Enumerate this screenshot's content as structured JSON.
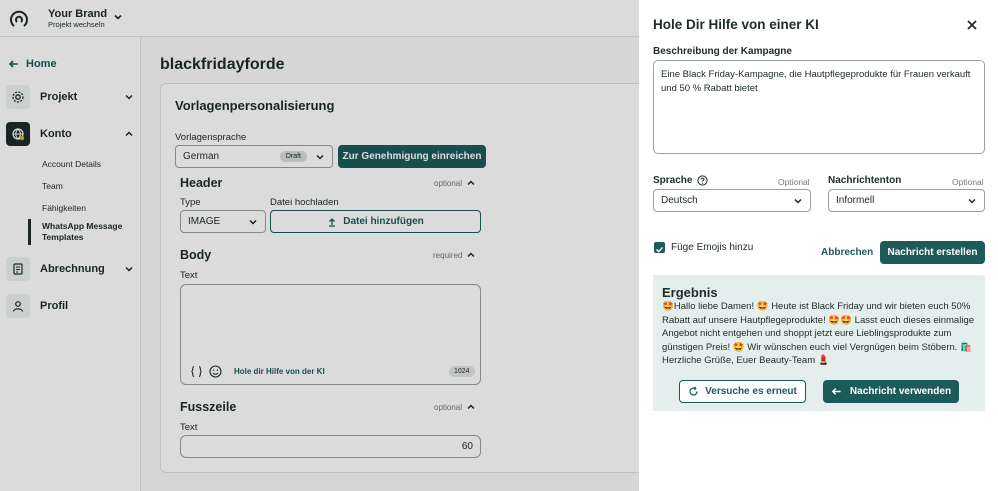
{
  "brand": {
    "name": "Your Brand",
    "subtitle": "Projekt wechseln"
  },
  "sidebar": {
    "home": "Home",
    "sections": [
      {
        "label": "Projekt",
        "icon": "gear-icon"
      },
      {
        "label": "Konto",
        "icon": "globe-icon"
      },
      {
        "label": "Abrechnung",
        "icon": "invoice-icon"
      },
      {
        "label": "Profil",
        "icon": "user-icon"
      }
    ],
    "konto_items": [
      "Account Details",
      "Team",
      "Fähigkeiten",
      "WhatsApp Message Templates"
    ]
  },
  "main": {
    "title": "blackfridayforde",
    "card_title": "Vorlagenpersonalisierung",
    "language_label": "Vorlagensprache",
    "language_value": "German",
    "draft_badge": "Draft",
    "submit_button": "Zur Genehmigung einreichen",
    "header": {
      "title": "Header",
      "tag": "optional",
      "type_label": "Type",
      "type_value": "IMAGE",
      "upload_label": "Datei hochladen",
      "upload_button": "Datei hinzufügen"
    },
    "body": {
      "title": "Body",
      "tag": "required",
      "text_label": "Text",
      "ai_link": "Hole dir Hilfe von der KI",
      "counter": "1024"
    },
    "footer": {
      "title": "Fusszeile",
      "tag": "optional",
      "text_label": "Text",
      "counter": "60"
    }
  },
  "drawer": {
    "title": "Hole Dir Hilfe von einer KI",
    "desc_label": "Beschreibung der Kampagne",
    "desc_value": "Eine Black Friday-Kampagne, die Hautpflegeprodukte für Frauen verkauft und 50 % Rabatt bietet",
    "language_label": "Sprache",
    "language_optional": "Optional",
    "language_value": "Deutsch",
    "tone_label": "Nachrichtenton",
    "tone_optional": "Optional",
    "tone_value": "Informell",
    "emoji_label": "Füge Emojis hinzu",
    "cancel": "Abbrechen",
    "create": "Nachricht erstellen",
    "result_title": "Ergebnis",
    "result_text": "🤩Hallo liebe Damen! 🤩 Heute ist Black Friday und wir bieten euch 50% Rabatt auf unsere Hautpflegeprodukte! 🤩🤩 Lasst euch dieses einmalige Angebot nicht entgehen und shoppt jetzt eure Lieblingsprodukte zum günstigen Preis! 🤩 Wir wünschen euch viel Vergnügen beim Stöbern. 🛍️ Herzliche Grüße, Euer Beauty-Team 💄",
    "retry": "Versuche es erneut",
    "use": "Nachricht verwenden"
  },
  "colors": {
    "accent": "#1d5b5b",
    "result_bg": "#e4eeec"
  }
}
